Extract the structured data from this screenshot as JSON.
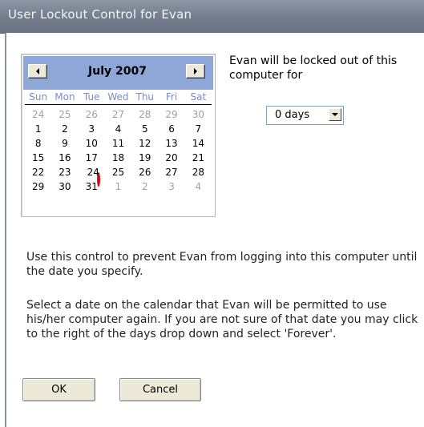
{
  "window": {
    "title": "User Lockout Control for Evan"
  },
  "calendar": {
    "month_label": "July 2007",
    "day_headers": [
      "Sun",
      "Mon",
      "Tue",
      "Wed",
      "Thu",
      "Fri",
      "Sat"
    ],
    "weeks": [
      [
        "24",
        "25",
        "26",
        "27",
        "28",
        "29",
        "30"
      ],
      [
        "1",
        "2",
        "3",
        "4",
        "5",
        "6",
        "7"
      ],
      [
        "8",
        "9",
        "10",
        "11",
        "12",
        "13",
        "14"
      ],
      [
        "15",
        "16",
        "17",
        "18",
        "19",
        "20",
        "21"
      ],
      [
        "22",
        "23",
        "24",
        "25",
        "26",
        "27",
        "28"
      ],
      [
        "29",
        "30",
        "31",
        "1",
        "2",
        "3",
        "4"
      ]
    ],
    "selected_date": "24",
    "prev_icon": "triangle-left-icon",
    "next_icon": "triangle-right-icon",
    "header_color": "#8ea7d6",
    "selection_circle_color": "#d01010"
  },
  "lockout": {
    "message": "Evan will be locked out of this computer for",
    "days_value": "0 days"
  },
  "instructions": {
    "paragraph1": "Use this control to prevent Evan from logging into this computer until the date you specify.",
    "paragraph2": "Select a date on the calendar that Evan will be permitted to use his/her computer again. If you are not sure of that date you may click to the right of the days drop down and select 'Forever'."
  },
  "buttons": {
    "ok_label": "OK",
    "cancel_label": "Cancel"
  }
}
